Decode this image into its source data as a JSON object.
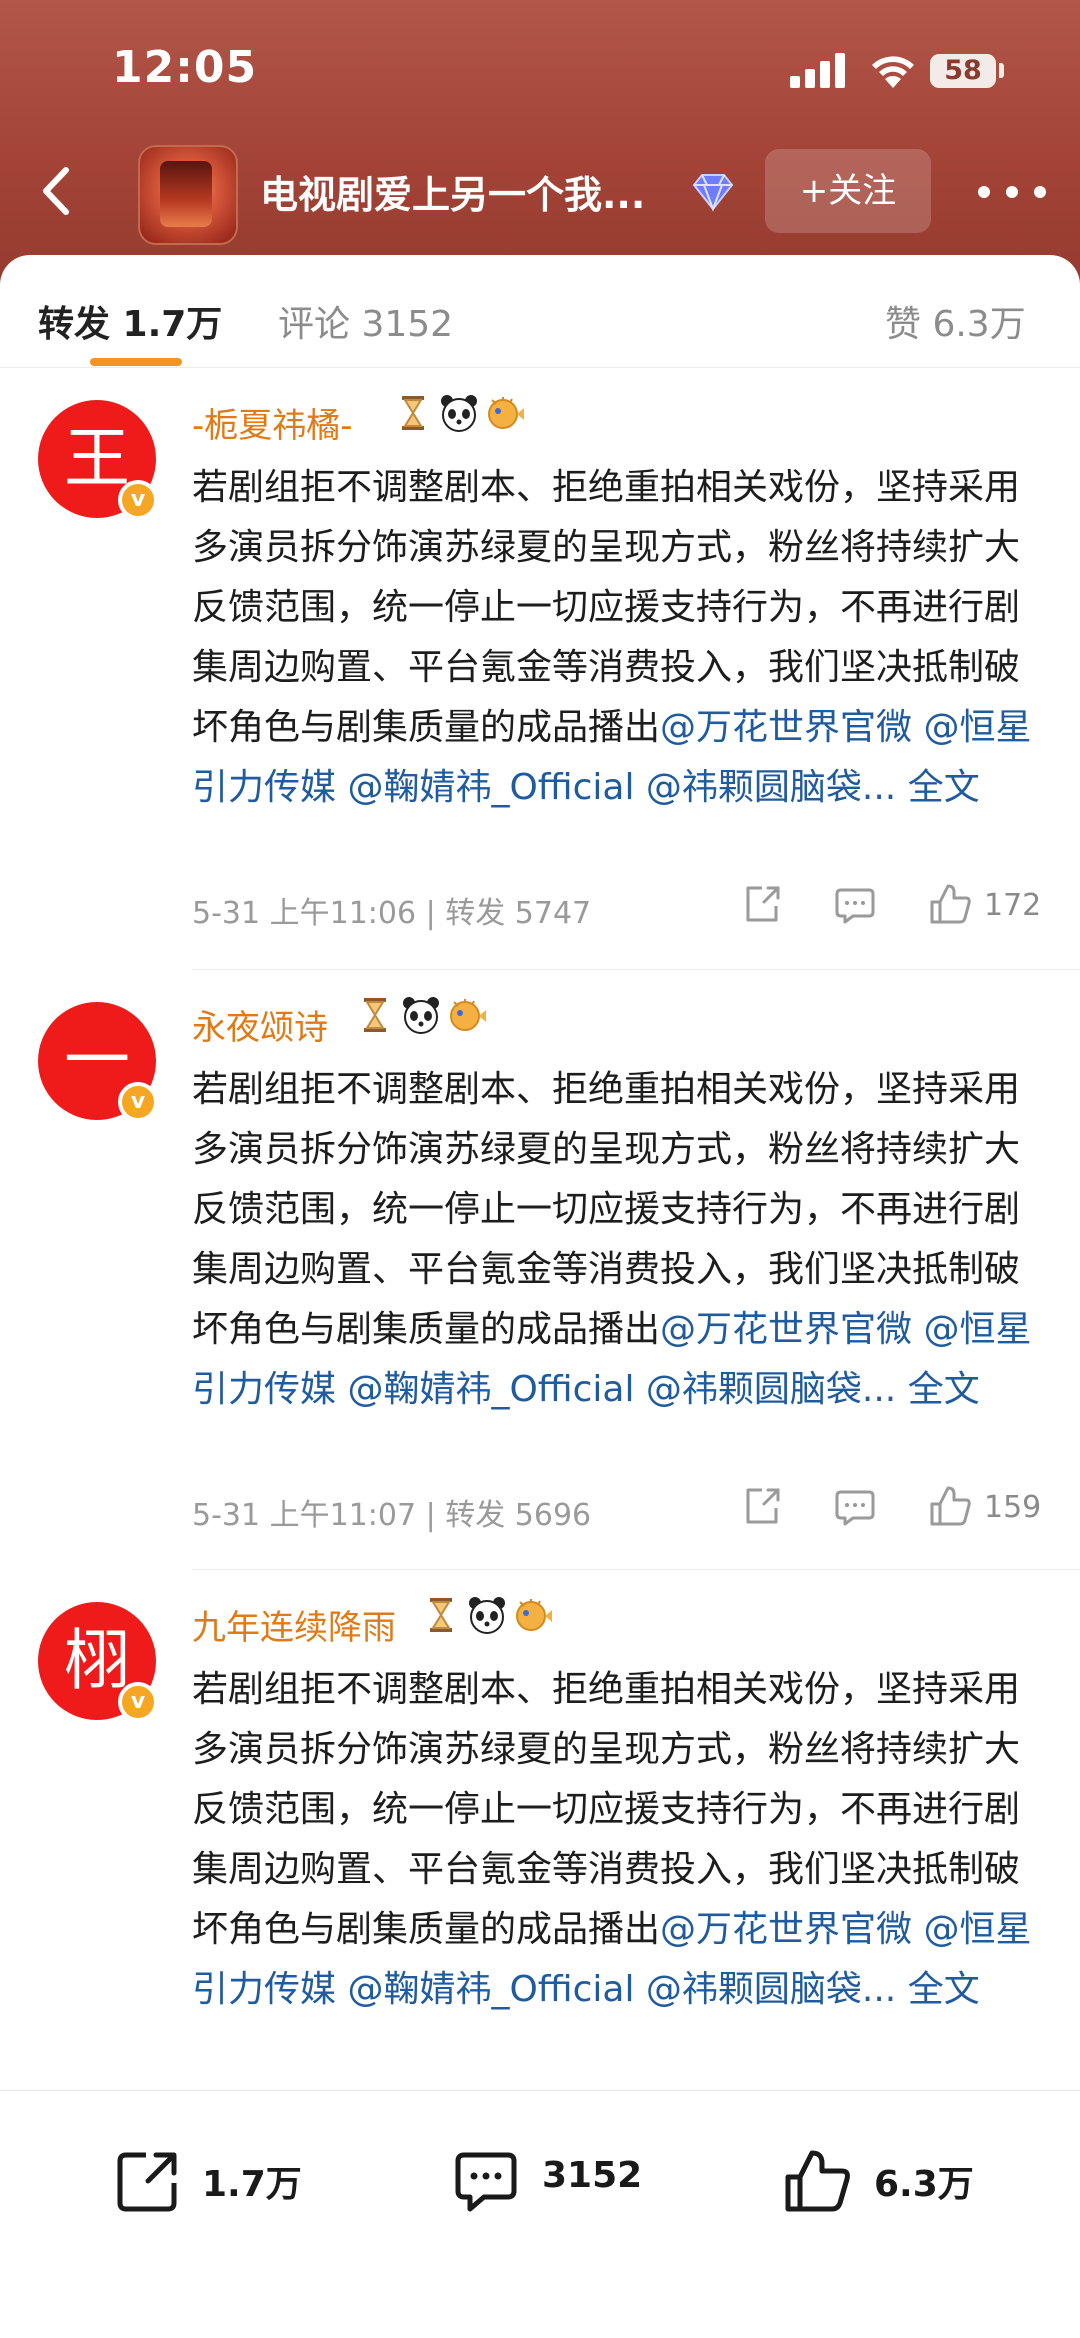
{
  "status_bar": {
    "time": "12:05",
    "battery": "58"
  },
  "nav": {
    "title": "电视剧爱上另一个我...",
    "follow_label": "+关注"
  },
  "tabs": {
    "repost": "转发 1.7万",
    "comment": "评论 3152",
    "like": "赞 6.3万"
  },
  "posts": [
    {
      "avatar_char": "王",
      "username": "-栀夏祎橘-",
      "text": "若剧组拒不调整剧本、拒绝重拍相关戏份，坚持采用多演员拆分饰演苏绿夏的呈现方式，粉丝将持续扩大反馈范围，统一停止一切应援支持行为，不再进行剧集周边购置、平台氪金等消费投入，我们坚决抵制破坏角色与剧集质量的成品播出",
      "mentions": [
        "@万花世界官微",
        "@恒星引力传媒",
        "@鞠婧祎_Official",
        "@祎颗圆脑袋..."
      ],
      "full_text": "全文",
      "meta": "5-31 上午11:06 | 转发 5747",
      "likes": "172"
    },
    {
      "avatar_char": "一",
      "username": "永夜颂诗",
      "text": "若剧组拒不调整剧本、拒绝重拍相关戏份，坚持采用多演员拆分饰演苏绿夏的呈现方式，粉丝将持续扩大反馈范围，统一停止一切应援支持行为，不再进行剧集周边购置、平台氪金等消费投入，我们坚决抵制破坏角色与剧集质量的成品播出",
      "mentions": [
        "@万花世界官微",
        "@恒星引力传媒",
        "@鞠婧祎_Official",
        "@祎颗圆脑袋..."
      ],
      "full_text": "全文",
      "meta": "5-31 上午11:07 | 转发 5696",
      "likes": "159"
    },
    {
      "avatar_char": "栩",
      "username": "九年连续降雨",
      "text": "若剧组拒不调整剧本、拒绝重拍相关戏份，坚持采用多演员拆分饰演苏绿夏的呈现方式，粉丝将持续扩大反馈范围，统一停止一切应援支持行为，不再进行剧集周边购置、平台氪金等消费投入，我们坚决抵制破坏角色与剧集质量的成品播出",
      "mentions": [
        "@万花世界官微",
        "@恒星引力传媒",
        "@鞠婧祎_Official",
        "@祎颗圆脑袋..."
      ],
      "full_text": "全文"
    }
  ],
  "bottom_bar": {
    "repost": "1.7万",
    "comment": "3152",
    "like": "6.3万"
  },
  "colors": {
    "header": "#a24336",
    "accent_orange": "#f59323",
    "username": "#e07a16",
    "mention": "#1f5b9e",
    "avatar_red": "#ef1b1b",
    "badge_gold": "#f5a623"
  },
  "icons": [
    "back-arrow-icon",
    "diamond-icon",
    "more-icon",
    "share-icon",
    "comment-icon",
    "like-icon",
    "hourglass-icon",
    "panda-icon",
    "pufferfish-icon",
    "verified-badge-icon"
  ]
}
